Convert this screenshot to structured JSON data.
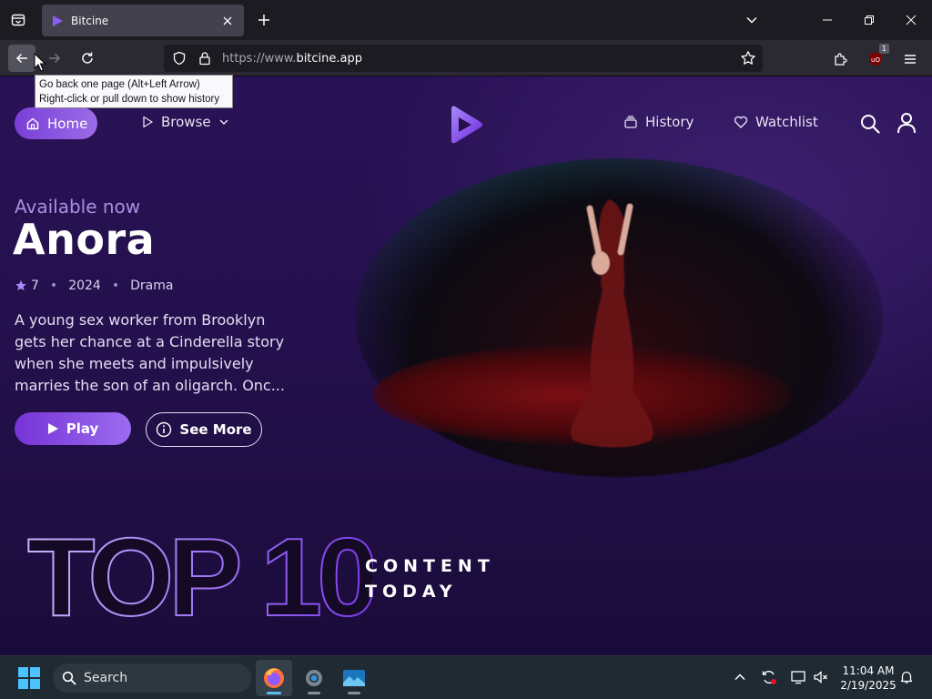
{
  "browser": {
    "tab_title": "Bitcine",
    "url_prefix": "https://www.",
    "url_domain": "bitcine.app",
    "extension_badge": "1",
    "tooltip_line1": "Go back one page (Alt+Left Arrow)",
    "tooltip_line2": "Right-click or pull down to show history"
  },
  "site": {
    "nav": {
      "home": "Home",
      "browse": "Browse",
      "history": "History",
      "watchlist": "Watchlist"
    },
    "hero": {
      "label": "Available now",
      "title": "Anora",
      "rating": "7",
      "year": "2024",
      "genre": "Drama",
      "description": "A young sex worker from Brooklyn gets her chance at a Cinderella story when she meets and impulsively marries the son of an oligarch. Onc...",
      "play_label": "Play",
      "more_label": "See More"
    },
    "top10": {
      "big": "TOP 10",
      "line1": "CONTENT",
      "line2": "TODAY"
    },
    "accent_color": "#8b5cf6"
  },
  "taskbar": {
    "search_label": "Search",
    "time": "11:04 AM",
    "date": "2/19/2025"
  }
}
